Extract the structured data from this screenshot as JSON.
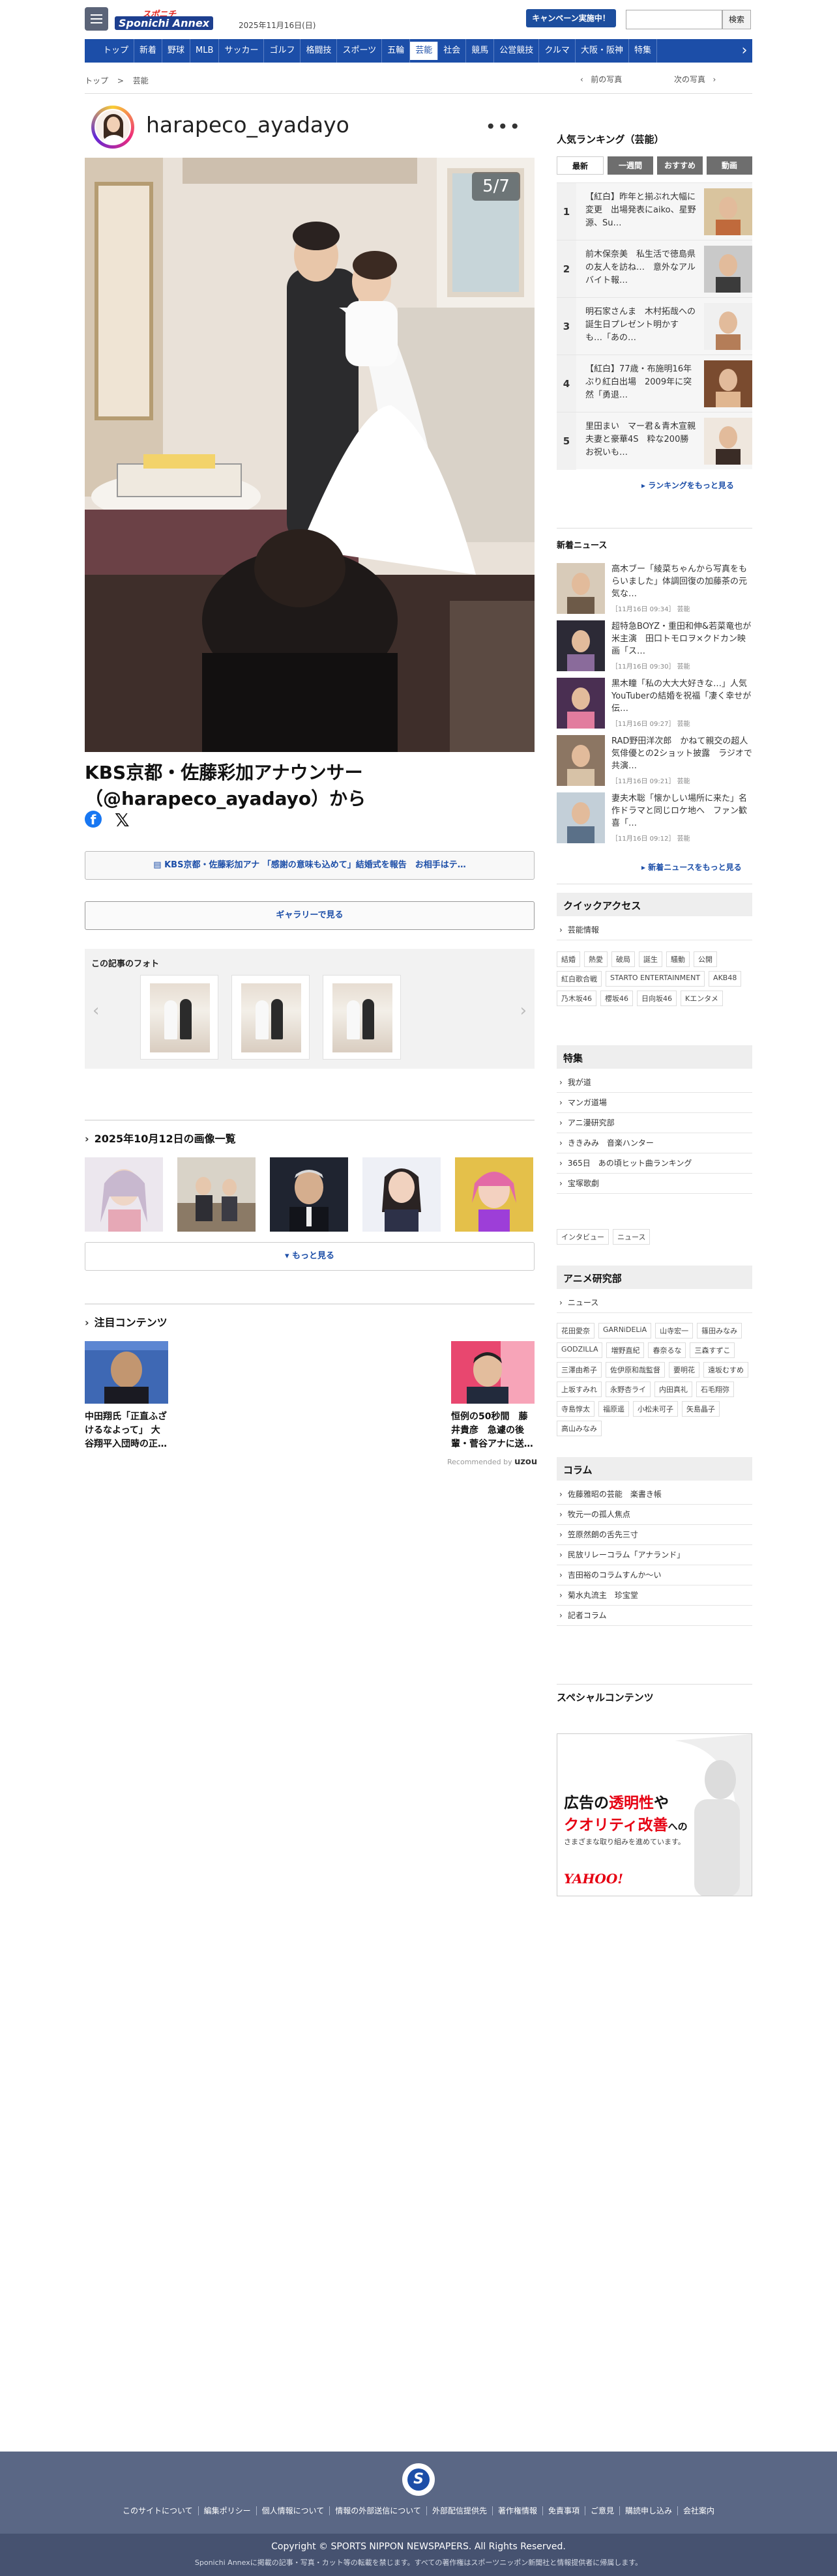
{
  "header": {
    "logo_top": "スポニチ",
    "logo_main": "Sponichi Annex",
    "date": "2025年11月16日(日)",
    "campaign": "キャンペーン実施中！",
    "search_placeholder": "",
    "search_button": "検索"
  },
  "nav": [
    "トップ",
    "新着",
    "野球",
    "MLB",
    "サッカー",
    "ゴルフ",
    "格闘技",
    "スポーツ",
    "五輪",
    "芸能",
    "社会",
    "競馬",
    "公営競技",
    "クルマ",
    "大阪・阪神",
    "特集"
  ],
  "nav_active": "芸能",
  "breadcrumb": {
    "home": "トップ",
    "sep": ">",
    "current": "芸能"
  },
  "photo_nav": {
    "prev": "前の写真",
    "next": "次の写真"
  },
  "instagram": {
    "username": "harapeco_ayadayo",
    "menu": "•••"
  },
  "photo": {
    "counter": "5/7"
  },
  "article": {
    "title": "KBS京都・佐藤彩加アナウンサー（@harapeco_ayadayo）から"
  },
  "related_link": "KBS京都・佐藤彩加アナ 「感謝の意味も込めて」結婚式を報告　お相手はテ…",
  "gallery_button": "ギャラリーで見る",
  "article_photos": {
    "title": "この記事のフォト"
  },
  "image_list": {
    "title": "2025年10月12日の画像一覧",
    "more": "もっと見る"
  },
  "featured": {
    "title": "注目コンテンツ",
    "items": [
      {
        "text": "中田翔氏「正直ふざけるなよって」 大谷翔平入団時の正…"
      },
      {
        "text": "恒例の50秒間　藤井貴彦　急遽の後輩・菅谷アナに送…"
      }
    ],
    "recommended_label": "Recommended by",
    "recommended_brand": "uzou"
  },
  "ranking": {
    "title": "人気ランキング（芸能）",
    "tabs": [
      "最新",
      "一週間",
      "おすすめ",
      "動画"
    ],
    "items": [
      {
        "no": "1",
        "text": "【紅白】昨年と揃ぶれ大幅に変更　出場発表にaiko、星野源、Su…"
      },
      {
        "no": "2",
        "text": "前木保奈美　私生活で徳島県の友人を訪ね…　意外なアルバイト報…"
      },
      {
        "no": "3",
        "text": "明石家さんま　木村拓哉への誕生日プレゼント明かす も…「あの…"
      },
      {
        "no": "4",
        "text": "【紅白】77歳・布施明16年ぶり紅白出場　2009年に突然「勇退…"
      },
      {
        "no": "5",
        "text": "里田まい　マー君＆青木宣親夫妻と豪華4S　粋な200勝お祝いも…"
      }
    ],
    "more": "ランキングをもっと見る"
  },
  "news": {
    "title": "新着ニュース",
    "items": [
      {
        "text": "高木ブー「綾菜ちゃんから写真をもらいました」体調回復の加藤茶の元気な…",
        "meta": "［11月16日 09:34］ 芸能"
      },
      {
        "text": "超特急BOYZ・重田和伸&若菜竜也が米主演　田口トモロヲ×クドカン映画「ス…",
        "meta": "［11月16日 09:30］ 芸能"
      },
      {
        "text": "黒木瞳「私の大大大好きな…」人気YouTuberの結婚を祝福「凄く幸せが伝…",
        "meta": "［11月16日 09:27］ 芸能"
      },
      {
        "text": "RAD野田洋次郎　かねて親交の超人気俳優との2ショット披露　ラジオで共演…",
        "meta": "［11月16日 09:21］ 芸能"
      },
      {
        "text": "妻夫木聡「懐かしい場所に来た」名作ドラマと同じロケ地へ　ファン歓喜「…",
        "meta": "［11月16日 09:12］ 芸能"
      }
    ],
    "more": "新着ニュースをもっと見る"
  },
  "quick": {
    "title": "クイックアクセス",
    "item": "芸能情報",
    "tags": [
      "結婚",
      "熱愛",
      "破局",
      "誕生",
      "騒動",
      "公開",
      "紅白歌合戦",
      "STARTO ENTERTAINMENT",
      "AKB48",
      "乃木坂46",
      "櫻坂46",
      "日向坂46",
      "Kエンタメ"
    ]
  },
  "special": {
    "title": "特集",
    "items": [
      "我が道",
      "マンガ道場",
      "アニ漫研究部",
      "ききみみ　音楽ハンター",
      "365日　あの頃ヒット曲ランキング",
      "宝塚歌劇"
    ],
    "tags": [
      "インタビュー",
      "ニュース"
    ]
  },
  "anime": {
    "title": "アニメ研究部",
    "item": "ニュース",
    "tags": [
      "花田愛奈",
      "GARNiDELiA",
      "山寺宏一",
      "篠田みなみ",
      "GODZILLA",
      "増野直紀",
      "春奈るな",
      "三森すずこ",
      "三澤由希子",
      "佐伊原和哉監督",
      "要明花",
      "遠坂むすめ",
      "上坂すみれ",
      "永野杏ライ",
      "内田真礼",
      "石毛翔弥",
      "寺島惇太",
      "福原遥",
      "小松未可子",
      "矢島晶子",
      "高山みなみ"
    ]
  },
  "column": {
    "title": "コラム",
    "items": [
      "佐藤雅昭の芸能　楽書き帳",
      "牧元一の孤人焦点",
      "笠原然朗の舌先三寸",
      "民放リレーコラム「アナランド」",
      "吉田裕のコラムすんか〜い",
      "菊水丸流主　珍宝堂",
      "記者コラム"
    ]
  },
  "special_contents": {
    "title": "スペシャルコンテンツ"
  },
  "ad": {
    "line1_a": "広告の",
    "line1_b": "透明性",
    "line1_c": "や",
    "line2_a": "クオリティ改善",
    "line2_b": "への",
    "line3": "さまざまな取り組みを進めています。",
    "brand": "YAHOO!"
  },
  "footer": {
    "links": [
      "このサイトについて",
      "編集ポリシー",
      "個人情報について",
      "情報の外部送信について",
      "外部配信提供先",
      "著作権情報",
      "免責事項",
      "ご意見",
      "購読申し込み",
      "会社案内"
    ],
    "copyright": "Copyright © SPORTS NIPPON NEWSPAPERS. All Rights Reserved.",
    "notice": "Sponichi Annexに掲載の記事・写真・カット等の転載を禁じます。すべての著作権はスポーツニッポン新聞社と情報提供者に帰属します。"
  },
  "colors": {
    "brand_blue": "#1c4ea8",
    "footer": "#5a6785",
    "accent_red": "#e3261e"
  }
}
